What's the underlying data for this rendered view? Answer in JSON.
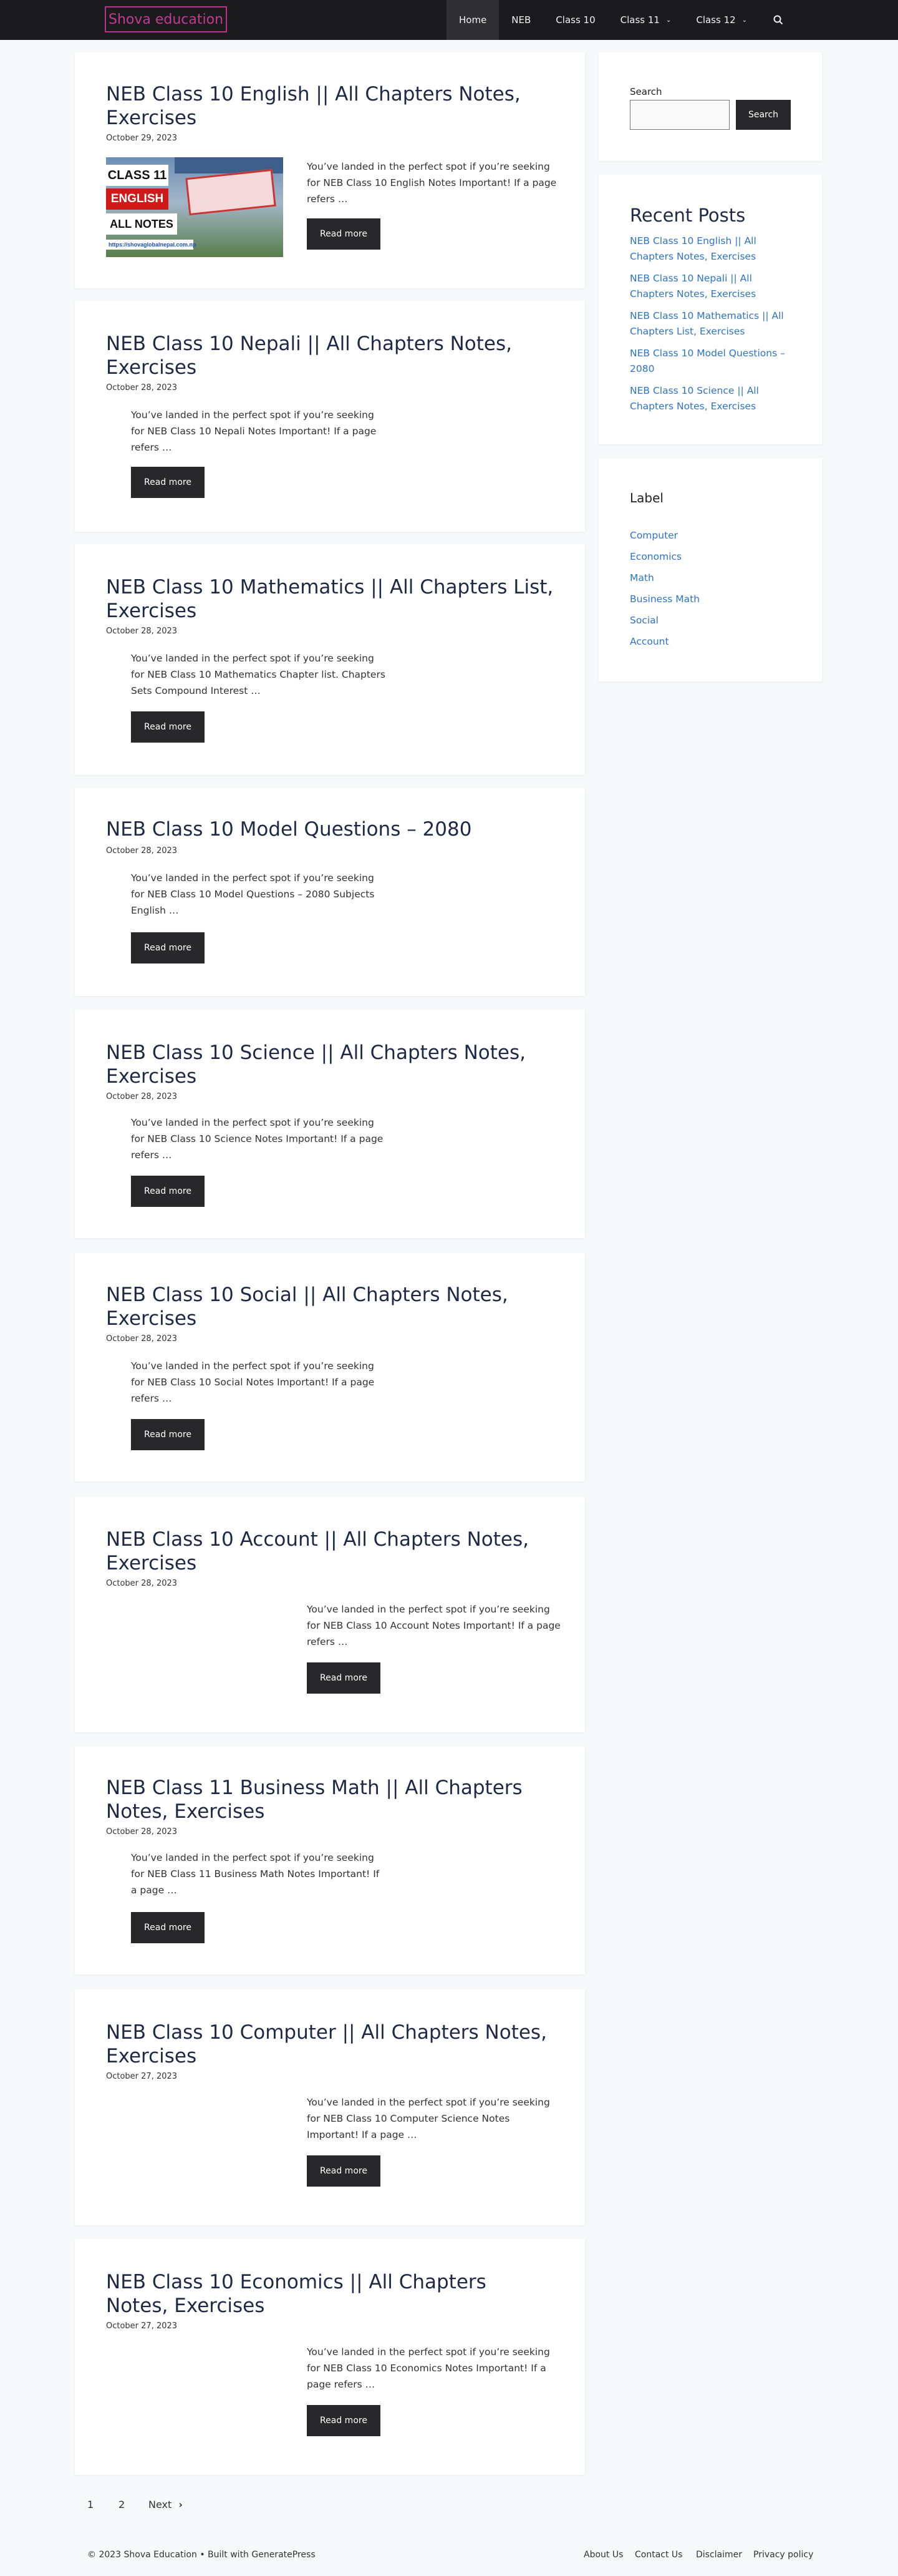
{
  "header": {
    "logo": "Shova education",
    "nav": [
      {
        "label": "Home",
        "active": true,
        "caret": false
      },
      {
        "label": "NEB",
        "active": false,
        "caret": false
      },
      {
        "label": "Class 10",
        "active": false,
        "caret": false
      },
      {
        "label": "Class 11",
        "active": false,
        "caret": true
      },
      {
        "label": "Class 12",
        "active": false,
        "caret": true
      }
    ],
    "search_icon": "search-icon"
  },
  "posts": [
    {
      "title": "NEB Class 10 English || All Chapters Notes, Exercises",
      "date": "October 29, 2023",
      "excerpt": "You’ve landed in the perfect spot if you’re seeking for NEB Class 10 English Notes Important! If a page refers …",
      "button": "Read more",
      "thumbnail": {
        "line1": "CLASS 11",
        "line2": "ENGLISH",
        "line3": "ALL NOTES",
        "url": "https://shovaglobalnepal.com.np"
      }
    },
    {
      "title": "NEB Class 10 Nepali || All Chapters Notes, Exercises",
      "date": "October 28, 2023",
      "excerpt": "You’ve landed in the perfect spot if you’re seeking for NEB Class 10 Nepali Notes Important! If a page refers …",
      "button": "Read more"
    },
    {
      "title": "NEB Class 10 Mathematics || All Chapters List, Exercises",
      "date": "October 28, 2023",
      "excerpt": "You’ve landed in the perfect spot if you’re seeking for NEB Class 10 Mathematics Chapter list. Chapters Sets Compound Interest …",
      "button": "Read more"
    },
    {
      "title": "NEB Class 10 Model Questions – 2080",
      "date": "October 28, 2023",
      "excerpt": "You’ve landed in the perfect spot if you’re seeking for NEB Class 10 Model Questions – 2080 Subjects English …",
      "button": "Read more"
    },
    {
      "title": "NEB Class 10 Science || All Chapters Notes, Exercises",
      "date": "October 28, 2023",
      "excerpt": "You’ve landed in the perfect spot if you’re seeking for NEB Class 10 Science Notes Important! If a page refers …",
      "button": "Read more"
    },
    {
      "title": "NEB Class 10 Social || All Chapters Notes, Exercises",
      "date": "October 28, 2023",
      "excerpt": "You’ve landed in the perfect spot if you’re seeking for NEB Class 10 Social Notes Important! If a page refers …",
      "button": "Read more"
    },
    {
      "title": "NEB Class 10 Account || All Chapters Notes, Exercises",
      "date": "October 28, 2023",
      "excerpt": "You’ve landed in the perfect spot if you’re seeking for NEB Class 10 Account Notes Important! If a page refers …",
      "button": "Read more"
    },
    {
      "title": "NEB Class 11 Business Math || All Chapters Notes, Exercises",
      "date": "October 28, 2023",
      "excerpt": "You’ve landed in the perfect spot if you’re seeking for NEB Class 11 Business Math Notes Important! If a page …",
      "button": "Read more"
    },
    {
      "title": "NEB Class 10 Computer || All Chapters Notes, Exercises",
      "date": "October 27, 2023",
      "excerpt": "You’ve landed in the perfect spot if you’re seeking for NEB Class 10 Computer Science Notes Important! If a page …",
      "button": "Read more"
    },
    {
      "title": "NEB Class 10 Economics || All Chapters Notes, Exercises",
      "date": "October 27, 2023",
      "excerpt": "You’ve landed in the perfect spot if you’re seeking for NEB Class 10 Economics Notes Important! If a page refers …",
      "button": "Read more"
    }
  ],
  "sidebar": {
    "search": {
      "label": "Search",
      "button": "Search",
      "value": ""
    },
    "recent": {
      "title": "Recent Posts",
      "items": [
        "NEB Class 10 English || All Chapters Notes, Exercises",
        "NEB Class 10 Nepali || All Chapters Notes, Exercises",
        "NEB Class 10 Mathematics || All Chapters List, Exercises",
        "NEB Class 10 Model Questions – 2080",
        "NEB Class 10 Science || All Chapters Notes, Exercises"
      ]
    },
    "labels": {
      "title": "Label",
      "items": [
        "Computer",
        "Economics",
        "Math",
        "Business Math",
        "Social",
        "Account"
      ]
    }
  },
  "pagination": {
    "pages": [
      "1",
      "2"
    ],
    "next": "Next",
    "next_icon": "chevron-right-icon"
  },
  "footer": {
    "copyright": "© 2023 Shova Education • Built with GeneratePress",
    "links": [
      "About Us",
      "Contact Us",
      "Disclaimer",
      "Privacy policy"
    ]
  }
}
